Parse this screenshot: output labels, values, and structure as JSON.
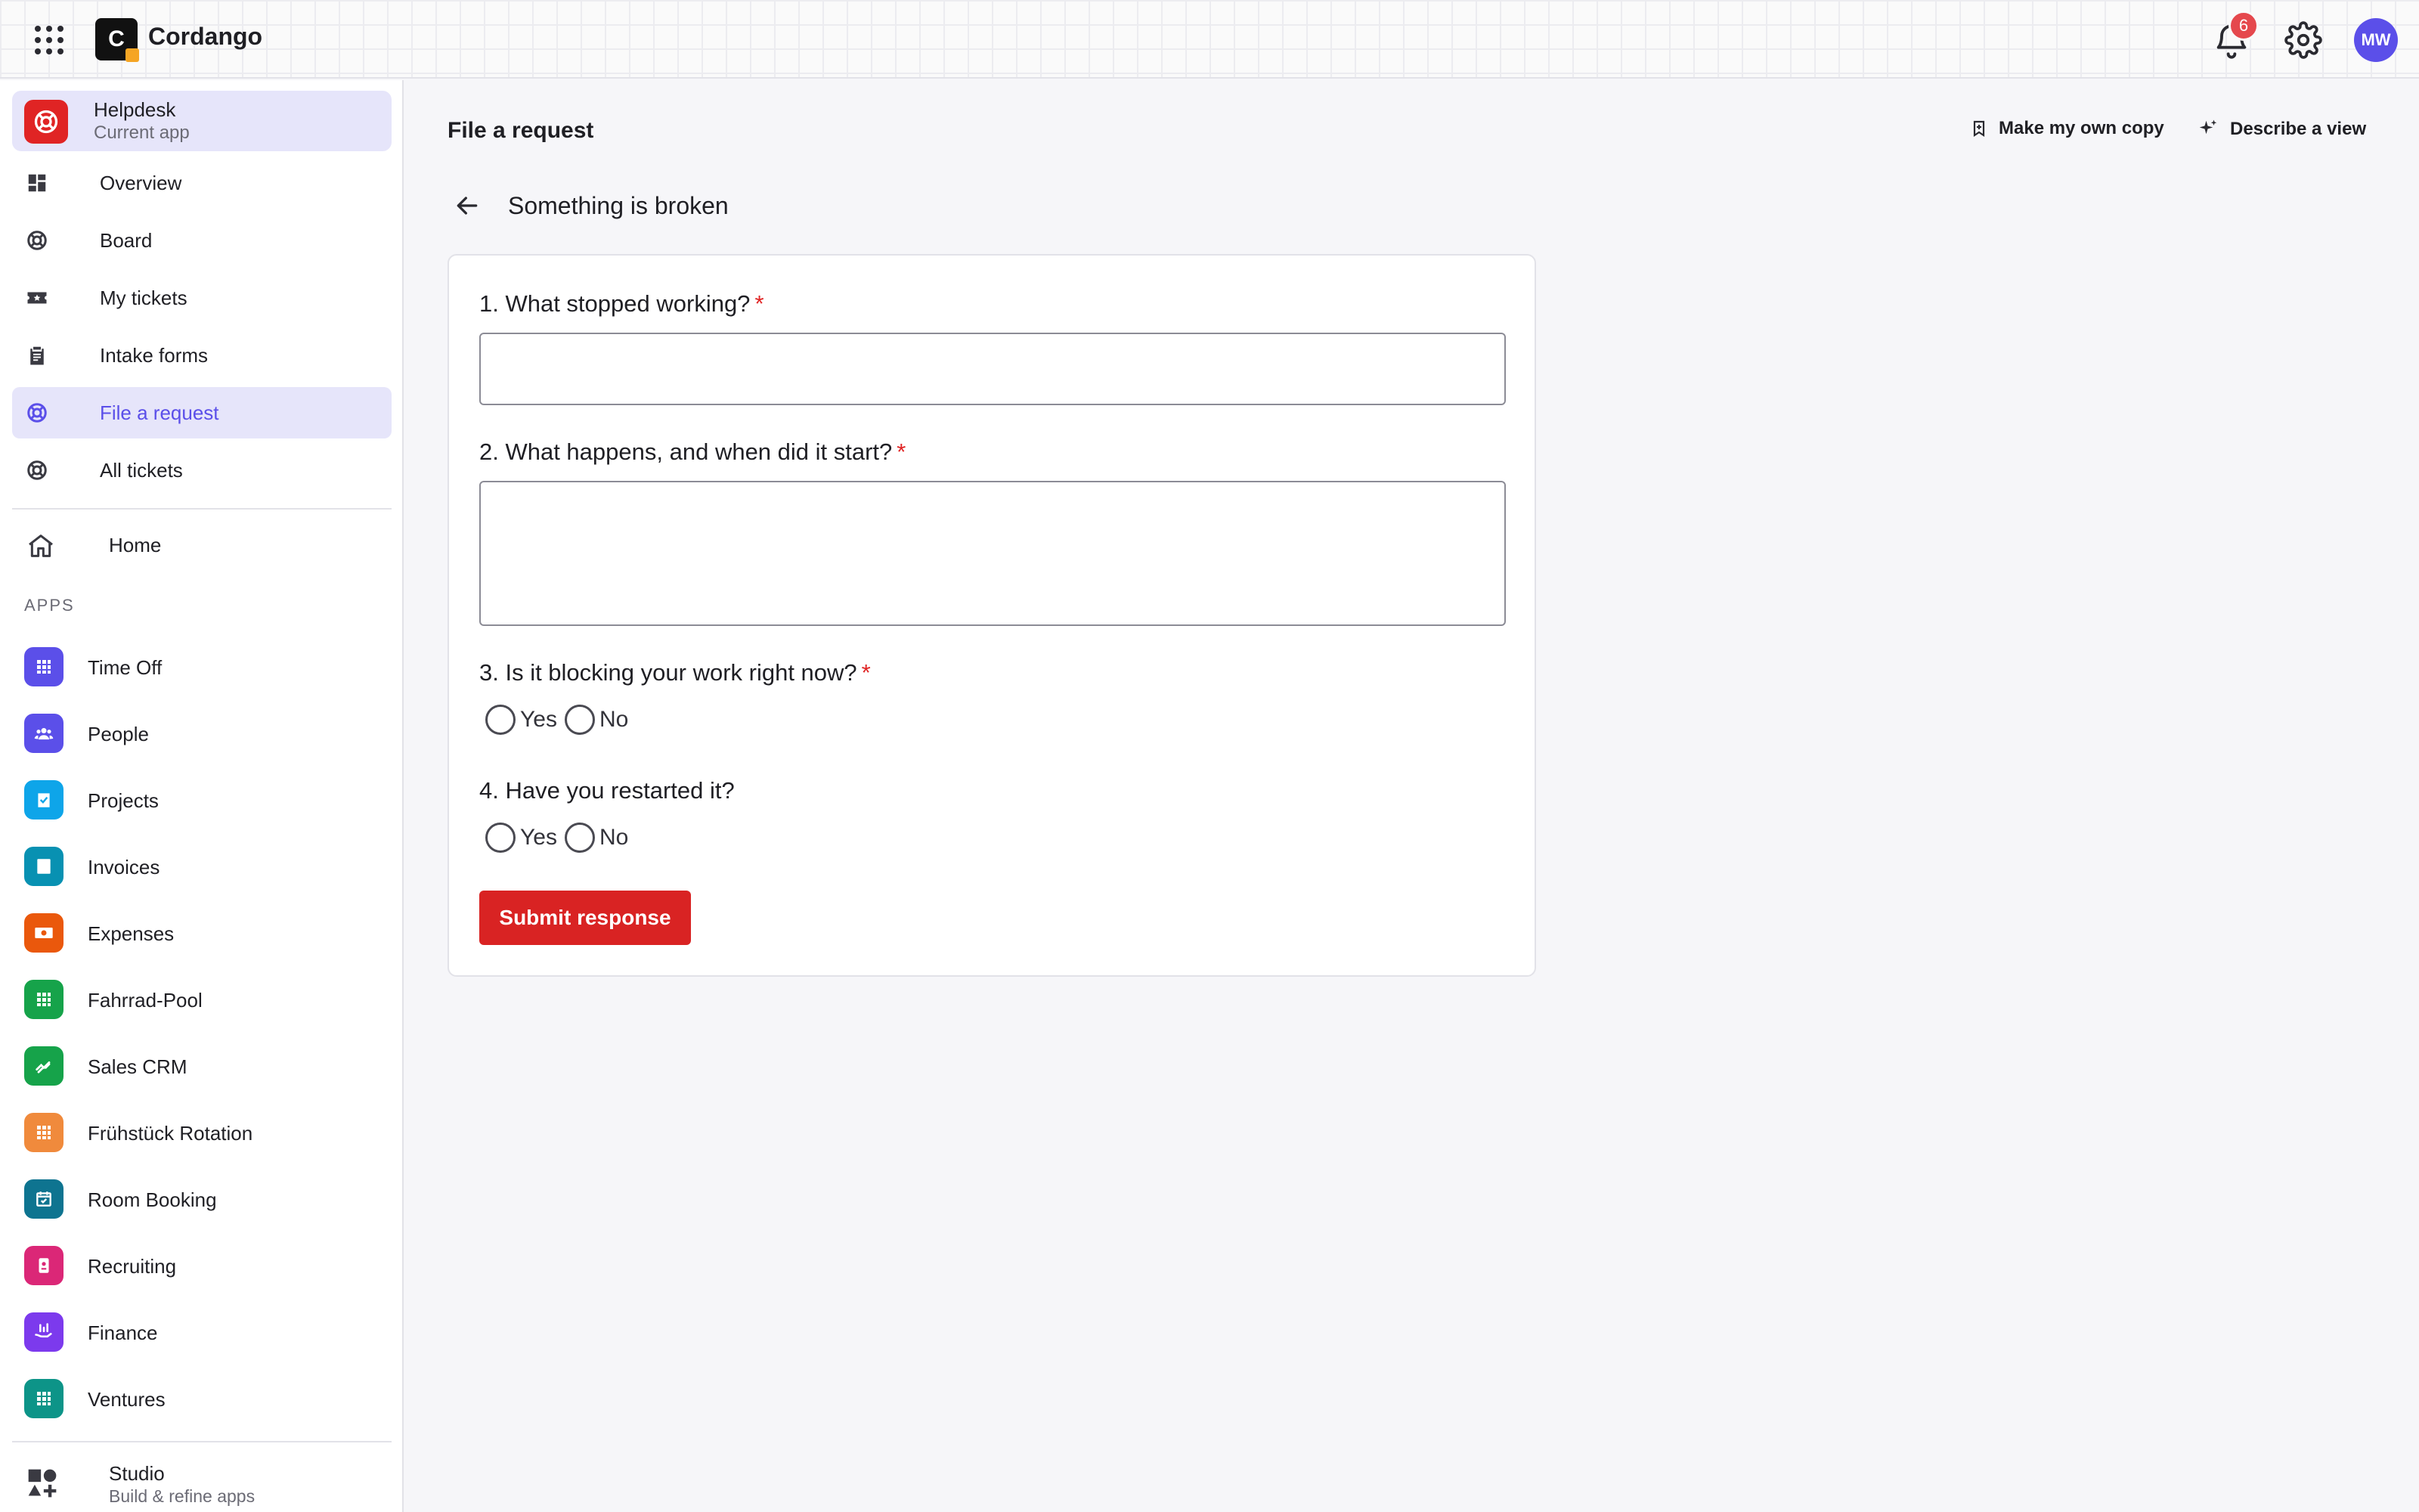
{
  "topbar": {
    "brand": "Cordango",
    "logo_letter": "C",
    "notification_count": "6",
    "user_initials": "MW"
  },
  "sidebar": {
    "current_app": {
      "name": "Helpdesk",
      "subtitle": "Current app"
    },
    "nav": [
      {
        "label": "Overview",
        "icon": "dashboard-icon"
      },
      {
        "label": "Board",
        "icon": "lifebuoy-icon"
      },
      {
        "label": "My tickets",
        "icon": "ticket-star-icon"
      },
      {
        "label": "Intake forms",
        "icon": "clipboard-icon"
      },
      {
        "label": "File a request",
        "icon": "lifebuoy-icon",
        "active": true
      },
      {
        "label": "All tickets",
        "icon": "lifebuoy-icon"
      }
    ],
    "home_label": "Home",
    "apps_heading": "APPS",
    "apps": [
      {
        "label": "Time Off",
        "color": "#5b4fe9"
      },
      {
        "label": "People",
        "color": "#5b4fe9"
      },
      {
        "label": "Projects",
        "color": "#0ea5e9"
      },
      {
        "label": "Invoices",
        "color": "#0891b2"
      },
      {
        "label": "Expenses",
        "color": "#ea580c"
      },
      {
        "label": "Fahrrad-Pool",
        "color": "#16a34a"
      },
      {
        "label": "Sales CRM",
        "color": "#16a34a"
      },
      {
        "label": "Frühstück Rotation",
        "color": "#f08a3c"
      },
      {
        "label": "Room Booking",
        "color": "#0e7490"
      },
      {
        "label": "Recruiting",
        "color": "#db2777"
      },
      {
        "label": "Finance",
        "color": "#7c3aed"
      },
      {
        "label": "Ventures",
        "color": "#0d9488"
      }
    ],
    "studio": {
      "name": "Studio",
      "subtitle": "Build & refine apps"
    }
  },
  "main": {
    "title": "File a request",
    "actions": {
      "copy": "Make my own copy",
      "describe": "Describe a view"
    },
    "form_title": "Something is broken",
    "questions": {
      "q1": "1. What stopped working?",
      "q2": "2. What happens, and when did it start?",
      "q3": "3. Is it blocking your work right now?",
      "q4": "4. Have you restarted it?"
    },
    "required_mark": "*",
    "options": {
      "yes": "Yes",
      "no": "No"
    },
    "submit_label": "Submit response"
  }
}
